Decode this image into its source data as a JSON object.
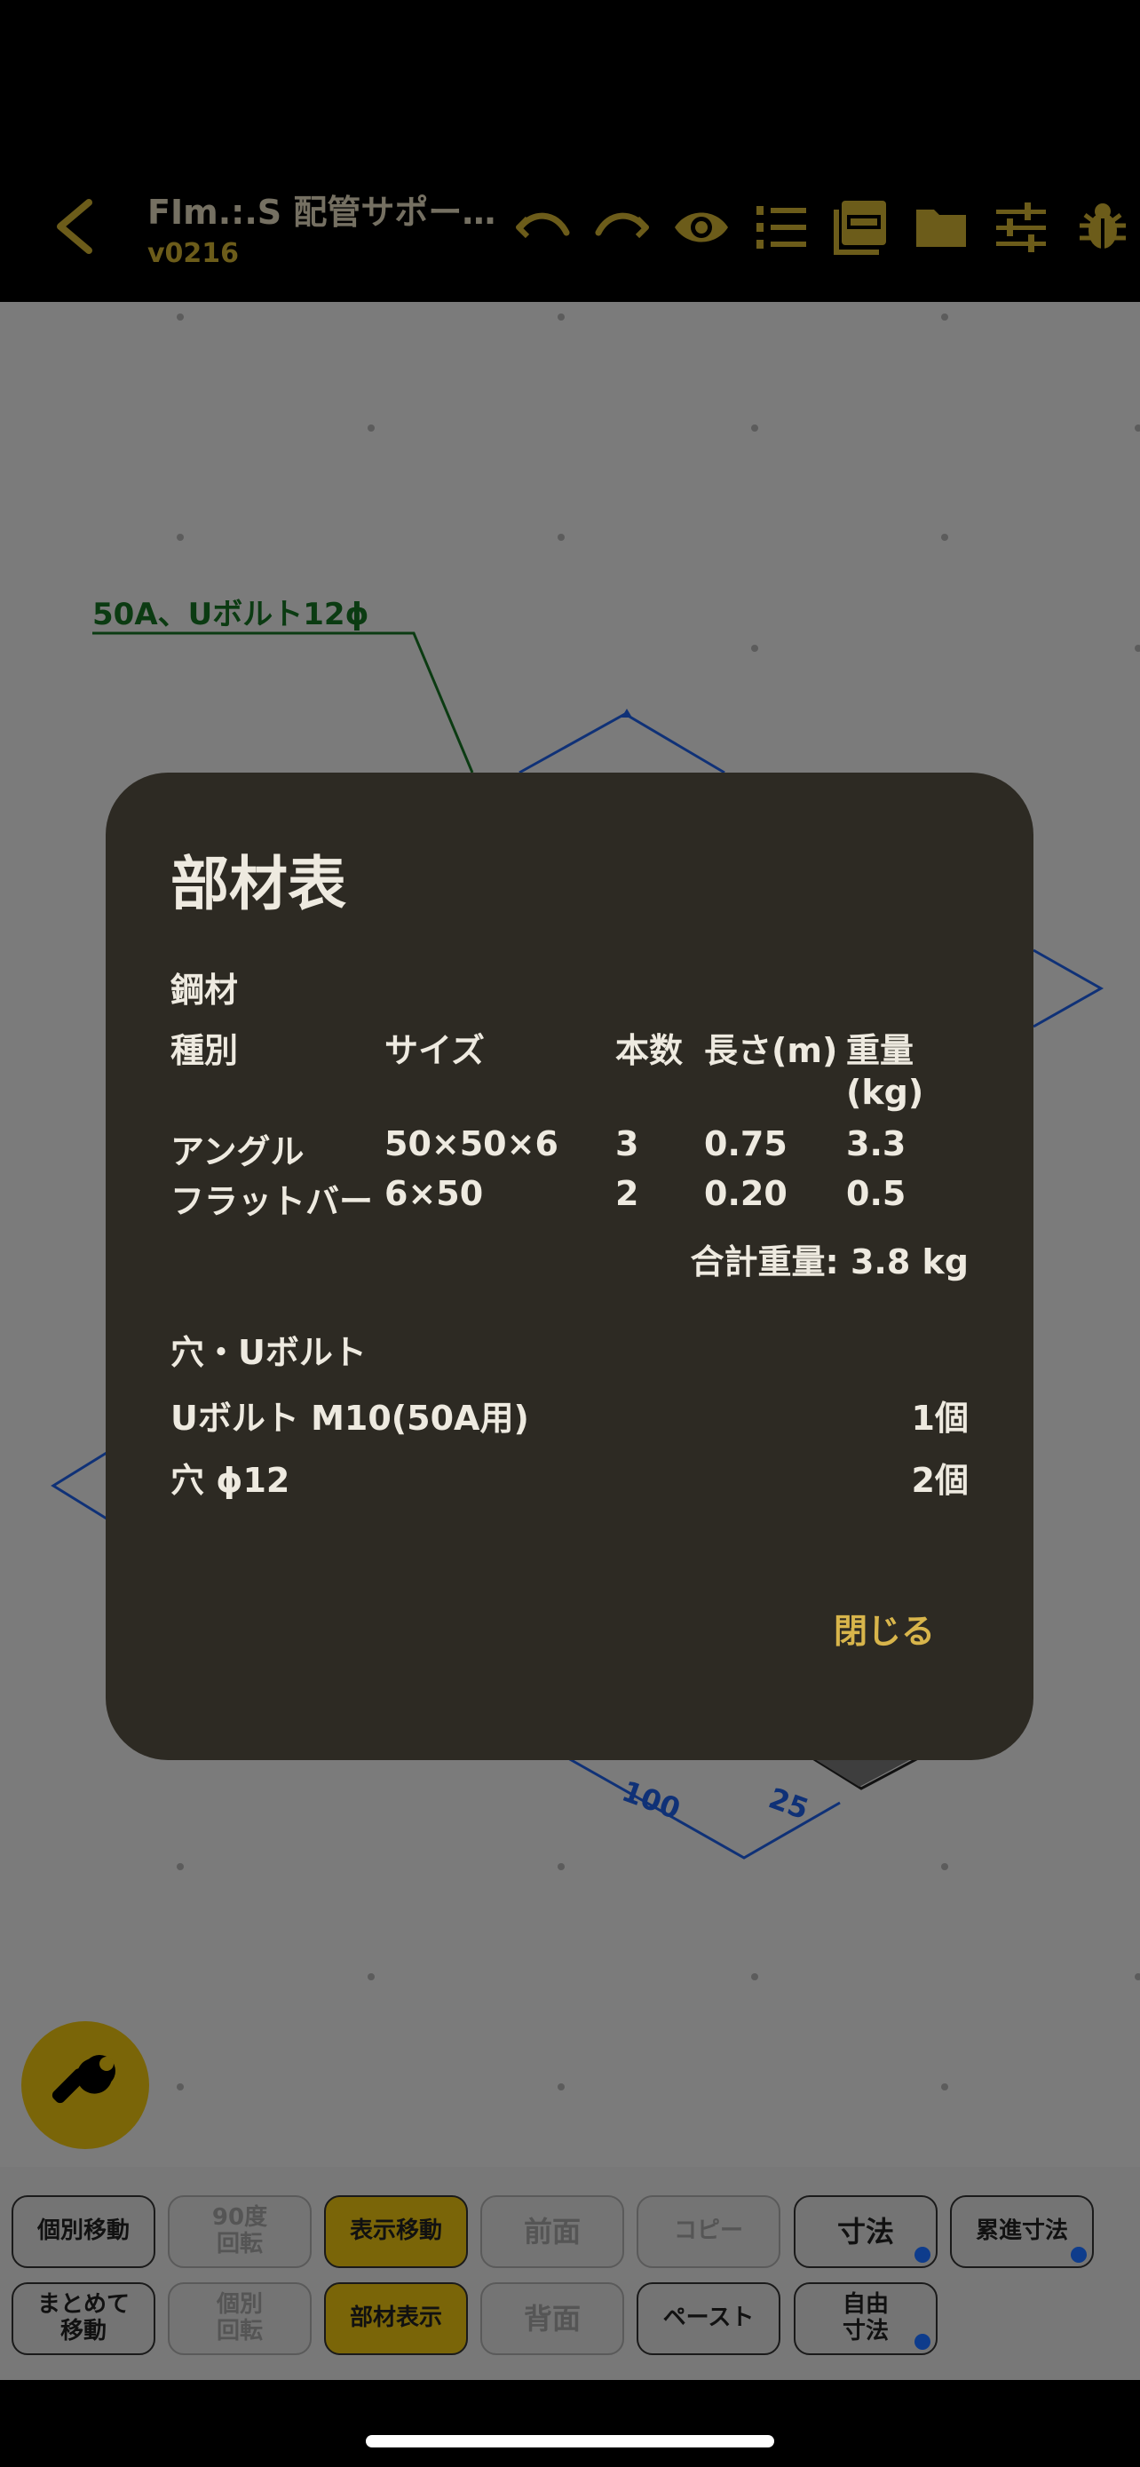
{
  "header": {
    "title": "FIm.:.S 配管サポー…",
    "version": "v0216",
    "icons": [
      "back-chevron-icon",
      "undo-icon",
      "redo-icon",
      "eye-icon",
      "numbered-list-icon",
      "pdf-icon",
      "folder-icon",
      "sliders-icon",
      "bug-icon"
    ],
    "accent_color": "#6c5c1a"
  },
  "canvas": {
    "annotation_label": "50A、Uボルト12ϕ",
    "dimension_100": "100",
    "dimension_25": "25"
  },
  "dialog": {
    "title": "部材表",
    "steel_section": "鋼材",
    "headers": {
      "type": "種別",
      "size": "サイズ",
      "count": "本数",
      "length": "長さ(m)",
      "weight_line1": "重量",
      "weight_line2": "(kg)"
    },
    "rows": [
      {
        "type": "アングル",
        "size": "50×50×6",
        "count": "3",
        "length": "0.75",
        "weight": "3.3"
      },
      {
        "type": "フラットバー",
        "size": "6×50",
        "count": "2",
        "length": "0.20",
        "weight": "0.5"
      }
    ],
    "total_weight": "合計重量: 3.8 kg",
    "hole_section": "穴・Uボルト",
    "hole_rows": [
      {
        "label": "Uボルト M10(50A用)",
        "qty": "1個"
      },
      {
        "label": "穴 ϕ12",
        "qty": "2個"
      }
    ],
    "close_label": "閉じる"
  },
  "toolbar": {
    "row1": [
      {
        "label": "個別移動",
        "state": "normal"
      },
      {
        "label": "90度\n回転",
        "state": "disabled"
      },
      {
        "label": "表示移動",
        "state": "active"
      },
      {
        "label": "前面",
        "state": "disabled"
      },
      {
        "label": "コピー",
        "state": "disabled"
      },
      {
        "label": "寸法",
        "state": "normal"
      },
      {
        "label": "累進寸法",
        "state": "normal"
      }
    ],
    "row2": [
      {
        "label": "まとめて\n移動",
        "state": "normal"
      },
      {
        "label": "個別\n回転",
        "state": "disabled"
      },
      {
        "label": "部材表示",
        "state": "active"
      },
      {
        "label": "背面",
        "state": "disabled"
      },
      {
        "label": "ペースト",
        "state": "normal"
      },
      {
        "label": "自由\n寸法",
        "state": "normal"
      }
    ]
  },
  "fab": {
    "icon": "wrench-icon"
  }
}
